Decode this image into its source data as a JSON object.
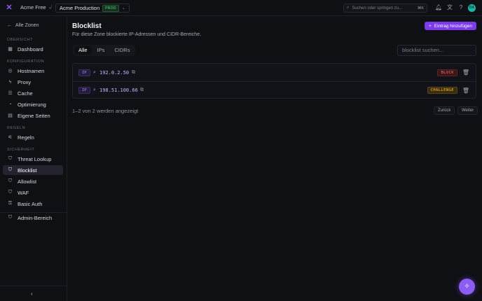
{
  "topbar": {
    "account": "Acme Free",
    "zone": "Acme Production",
    "zone_badge": "PROD",
    "search_placeholder": "Suchen oder springen zu...",
    "search_shortcut": "⌘K",
    "avatar_initials": "DA"
  },
  "sidebar": {
    "back": "Alle Zonen",
    "sections": {
      "overview": "ÜBERSICHT",
      "config": "KONFIGURATION",
      "rules": "REGELN",
      "security": "SICHERHEIT"
    },
    "items": {
      "dashboard": "Dashboard",
      "hostnames": "Hostnamen",
      "proxy": "Proxy",
      "cache": "Cache",
      "optimization": "Optimierung",
      "pages": "Eigene Seiten",
      "rules": "Regeln",
      "threat": "Threat Lookup",
      "blocklist": "Blocklist",
      "allowlist": "Allowlist",
      "waf": "WAF",
      "basicauth": "Basic Auth",
      "admin": "Admin-Bereich"
    }
  },
  "main": {
    "title": "Blocklist",
    "subtitle": "Für diese Zone blockierte IP-Adressen und CIDR-Bereiche.",
    "add_button": "Eintrag hinzufügen",
    "tabs": [
      "Alle",
      "IPs",
      "CIDRs"
    ],
    "filter_placeholder": "blocklist suchen...",
    "rows": [
      {
        "type": "IP",
        "value": "192.0.2.50",
        "action": "BLOCK"
      },
      {
        "type": "IP",
        "value": "198.51.100.66",
        "action": "CHALLENGE"
      }
    ],
    "count": "1–2 von 2 werden angezeigt",
    "prev": "Zurück",
    "next": "Weiter"
  },
  "colors": {
    "accent": "#7c3aed",
    "block": "#f87171",
    "challenge": "#fbbf24",
    "prod": "#4ade80"
  }
}
